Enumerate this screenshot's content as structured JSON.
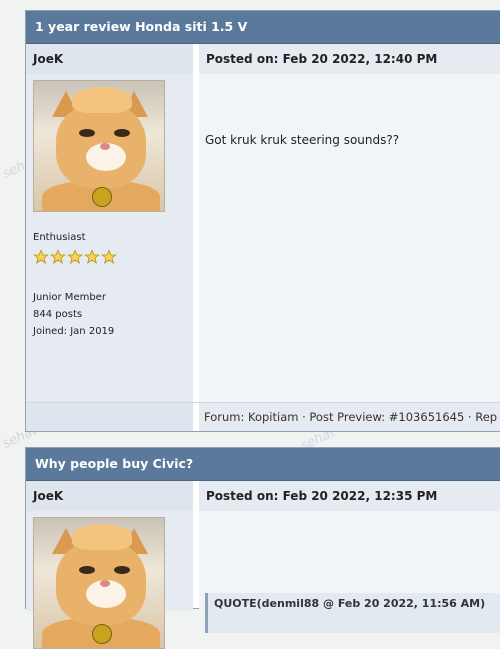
{
  "posts": [
    {
      "title": "1 year review Honda siti 1.5 V",
      "username": "JoeK",
      "posted": "Posted on: Feb 20 2022, 12:40 PM",
      "role": "Enthusiast",
      "stars": 5,
      "rank": "Junior Member",
      "post_count": "844 posts",
      "joined": "Joined: Jan 2019",
      "content": "Got kruk kruk steering sounds??",
      "footer": "Forum: Kopitiam · Post Preview: #103651645 · Rep"
    },
    {
      "title": "Why people buy Civic?",
      "username": "JoeK",
      "posted": "Posted on: Feb 20 2022, 12:35 PM",
      "quote_header": "QUOTE(denmil88 @ Feb 20 2022, 11:56 AM)"
    }
  ],
  "colors": {
    "title_bar": "#5b7a9b",
    "meta_bg": "#dfe5ec",
    "star": "#f0c419"
  },
  "icons": {
    "rating": "star-icon"
  }
}
